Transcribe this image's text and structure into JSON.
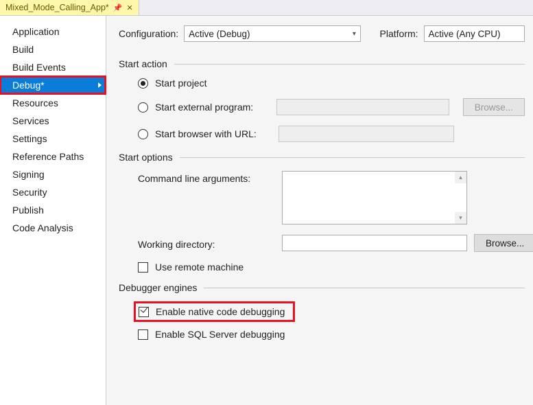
{
  "tab": {
    "title": "Mixed_Mode_Calling_App*"
  },
  "sidebar": {
    "items": [
      {
        "label": "Application"
      },
      {
        "label": "Build"
      },
      {
        "label": "Build Events"
      },
      {
        "label": "Debug*"
      },
      {
        "label": "Resources"
      },
      {
        "label": "Services"
      },
      {
        "label": "Settings"
      },
      {
        "label": "Reference Paths"
      },
      {
        "label": "Signing"
      },
      {
        "label": "Security"
      },
      {
        "label": "Publish"
      },
      {
        "label": "Code Analysis"
      }
    ]
  },
  "config": {
    "config_label": "Configuration:",
    "config_value": "Active (Debug)",
    "platform_label": "Platform:",
    "platform_value": "Active (Any CPU)"
  },
  "sections": {
    "start_action": "Start action",
    "start_options": "Start options",
    "debugger_engines": "Debugger engines"
  },
  "start_action": {
    "start_project": "Start project",
    "start_external": "Start external program:",
    "start_browser": "Start browser with URL:",
    "browse": "Browse..."
  },
  "start_options": {
    "cmd_args": "Command line arguments:",
    "working_dir": "Working directory:",
    "browse": "Browse...",
    "use_remote": "Use remote machine"
  },
  "debugger": {
    "native": "Enable native code debugging",
    "sql": "Enable SQL Server debugging"
  }
}
